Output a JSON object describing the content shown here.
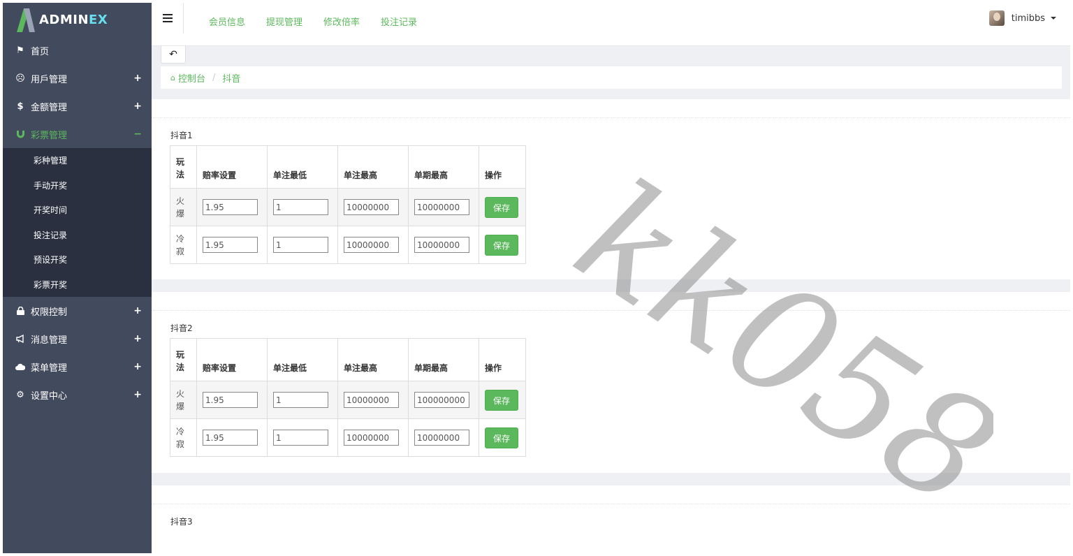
{
  "brand": {
    "prefix": "ADMIN",
    "suffix": "EX"
  },
  "sidebar": {
    "items": [
      {
        "label": "首页",
        "icon": "flag-icon",
        "toggle": ""
      },
      {
        "label": "用戶管理",
        "icon": "face-icon",
        "toggle": "+"
      },
      {
        "label": "金额管理",
        "icon": "dollar-icon",
        "toggle": "+"
      },
      {
        "label": "彩票管理",
        "icon": "magnet-icon",
        "toggle": "−"
      },
      {
        "label": "权限控制",
        "icon": "lock-icon",
        "toggle": "+"
      },
      {
        "label": "消息管理",
        "icon": "bullhorn-icon",
        "toggle": "+"
      },
      {
        "label": "菜单管理",
        "icon": "cloud-icon",
        "toggle": "+"
      },
      {
        "label": "设置中心",
        "icon": "gear-icon",
        "toggle": "+"
      }
    ],
    "submenu": [
      "彩种管理",
      "手动开奖",
      "开奖时间",
      "投注记录",
      "预设开奖",
      "彩票开奖"
    ]
  },
  "header": {
    "nav": [
      "会员信息",
      "提现管理",
      "修改倍率",
      "投注记录"
    ],
    "username": "timibbs"
  },
  "breadcrumb": {
    "home": "控制台",
    "current": "抖音"
  },
  "table_headers": [
    "玩法",
    "赔率设置",
    "单注最低",
    "单注最高",
    "单期最高",
    "操作"
  ],
  "save_label": "保存",
  "panels": [
    {
      "title": "抖音1",
      "rows": [
        {
          "play": "火爆",
          "odds": "1.95",
          "min": "1",
          "max": "10000000",
          "period_max": "10000000"
        },
        {
          "play": "冷寂",
          "odds": "1.95",
          "min": "1",
          "max": "10000000",
          "period_max": "10000000"
        }
      ]
    },
    {
      "title": "抖音2",
      "rows": [
        {
          "play": "火爆",
          "odds": "1.95",
          "min": "1",
          "max": "10000000",
          "period_max": "100000000"
        },
        {
          "play": "冷寂",
          "odds": "1.95",
          "min": "1",
          "max": "10000000",
          "period_max": "10000000"
        }
      ]
    },
    {
      "title": "抖音3",
      "rows": []
    }
  ],
  "watermark": "kk058",
  "colors": {
    "sidebar": "#424a5d",
    "submenu": "#2a3040",
    "accent": "#5cb85c",
    "logo_accent": "#68dff0"
  }
}
